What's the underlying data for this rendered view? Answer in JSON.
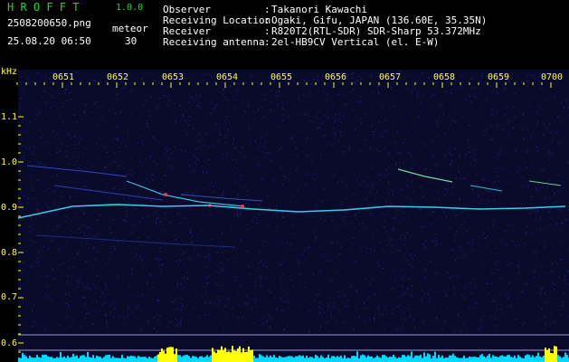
{
  "header": {
    "app_title": "H R O F F T",
    "version": "1.0.0",
    "file_name": "2508200650.png",
    "timestamp": "25.08.20 06:50",
    "meteor_label": "meteor",
    "meteor_count": "30",
    "info": [
      {
        "label": "Observer",
        "value": "Takanori Kawachi"
      },
      {
        "label": "Receiving Location",
        "value": "Ogaki, Gifu, JAPAN (136.60E, 35.35N)"
      },
      {
        "label": "Receiver",
        "value": "R820T2(RTL-SDR) SDR-Sharp 53.372MHz"
      },
      {
        "label": "Receiving antenna",
        "value": "2el-HB9CV Vertical (el. E-W)"
      }
    ],
    "separator": ":"
  },
  "spectrogram": {
    "unit": "kHz",
    "time_ticks": [
      "0651",
      "0652",
      "0653",
      "0654",
      "0655",
      "0656",
      "0657",
      "0658",
      "0659",
      "0700"
    ],
    "freq_ticks": [
      "1.1",
      "1.0",
      "0.9",
      "0.8",
      "0.7",
      "0.6"
    ],
    "colors": {
      "background": "#0a0a2a",
      "noise": "#2030a0",
      "signal": "#40e0ff",
      "meteor": "#ff3050",
      "level": "#ffff00",
      "baseline": "#00d8ff"
    }
  }
}
